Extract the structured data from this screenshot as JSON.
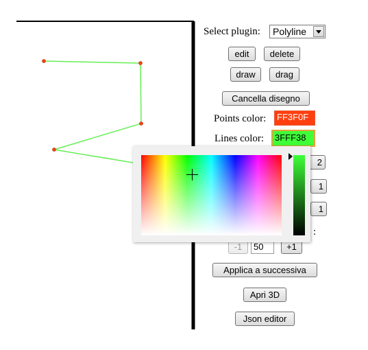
{
  "plugin": {
    "label": "Select plugin:",
    "selected": "Polyline"
  },
  "buttons": {
    "edit": "edit",
    "delete": "delete",
    "draw": "draw",
    "drag": "drag",
    "cancella": "Cancella disegno",
    "partial_top": "2",
    "partial_mid1": "1",
    "partial_mid2": "1",
    "minus": "-1",
    "plus": "+1",
    "applica": "Applica a successiva",
    "apri3d": "Apri 3D",
    "json": "Json editor"
  },
  "colors": {
    "points_label": "Points color:",
    "points_value": "FF3F0F",
    "points_hex": "#ff3f0f",
    "lines_label": "Lines color:",
    "lines_value": "3FFF38",
    "lines_hex": "#3fff38"
  },
  "partial_label": ":",
  "number_value": "50",
  "color_picker": {
    "selected_hex": "#3fff38",
    "value_level": 1.0
  }
}
